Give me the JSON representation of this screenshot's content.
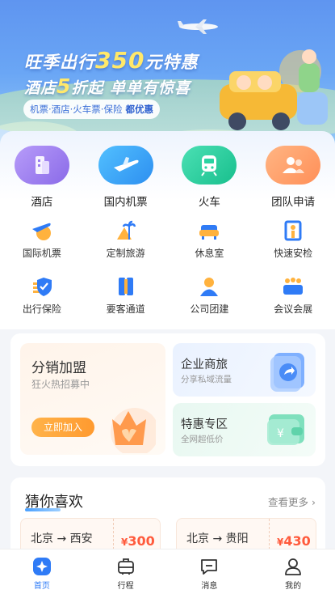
{
  "banner": {
    "title_a": "旺季出行",
    "title_num": "350",
    "title_b": "元特惠",
    "sub_a": "酒店",
    "sub_num": "5",
    "sub_b": "折起 单单有惊喜",
    "tagline": "机票·酒店·火车票·保险",
    "tagline_highlight": "都优惠"
  },
  "main_services": [
    {
      "label": "酒店",
      "icon": "hotel-icon",
      "color": "#9a7df0"
    },
    {
      "label": "国内机票",
      "icon": "plane-icon",
      "color": "#3aa6f5"
    },
    {
      "label": "火车",
      "icon": "train-icon",
      "color": "#2bd3a2"
    },
    {
      "label": "团队申请",
      "icon": "team-icon",
      "color": "#ff9b6a"
    }
  ],
  "sub_services": [
    {
      "label": "国际机票",
      "icon": "international-flight-icon"
    },
    {
      "label": "定制旅游",
      "icon": "custom-travel-icon"
    },
    {
      "label": "休息室",
      "icon": "lounge-icon"
    },
    {
      "label": "快速安检",
      "icon": "fast-security-icon"
    },
    {
      "label": "出行保险",
      "icon": "travel-insurance-icon"
    },
    {
      "label": "要客通道",
      "icon": "vip-channel-icon"
    },
    {
      "label": "公司团建",
      "icon": "team-building-icon"
    },
    {
      "label": "会议会展",
      "icon": "conference-icon"
    }
  ],
  "promo": {
    "left": {
      "title": "分销加盟",
      "subtitle": "狂火热招募中",
      "button": "立即加入"
    },
    "right_top": {
      "title": "企业商旅",
      "subtitle": "分享私域流量"
    },
    "right_bottom": {
      "title": "特惠专区",
      "subtitle": "全网超低价"
    }
  },
  "recommend": {
    "title": "猜你喜欢",
    "more": "查看更多 ›",
    "items": [
      {
        "route": "北京 → 西安",
        "currency": "¥",
        "price": "300"
      },
      {
        "route": "北京 → 贵阳",
        "currency": "¥",
        "price": "430"
      }
    ]
  },
  "tabs": [
    {
      "label": "首页",
      "icon": "home-icon",
      "active": true
    },
    {
      "label": "行程",
      "icon": "itinerary-icon",
      "active": false
    },
    {
      "label": "消息",
      "icon": "message-icon",
      "active": false
    },
    {
      "label": "我的",
      "icon": "profile-icon",
      "active": false
    }
  ],
  "colors": {
    "accent": "#2f7bf6",
    "price": "#ff5a3c",
    "join": "#ff9a2f"
  }
}
